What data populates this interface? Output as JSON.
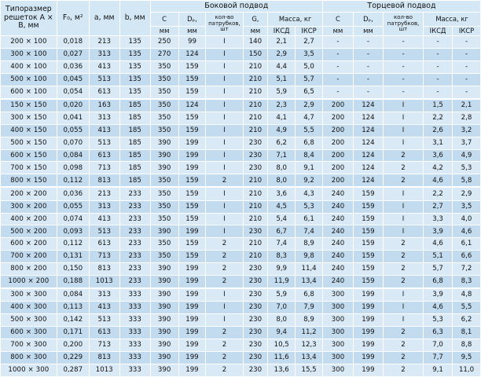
{
  "headers": {
    "size": "Типоразмер решеток А × В, мм",
    "f0": "F₀, м²",
    "a": "a, мм",
    "b": "b, мм",
    "side_group": "Боковой подвод",
    "end_group": "Торцевой подвод",
    "c": "С",
    "d": "Dₚ,",
    "count": "кол-во патрубков, шт",
    "g": "G,",
    "mass": "Масса, кг",
    "unit_mm": "мм",
    "ikcd": "IКСД",
    "ikcr": "IКСР"
  },
  "rows": [
    [
      "200 × 100",
      "0,018",
      "213",
      "135",
      "250",
      "99",
      "I",
      "140",
      "2,1",
      "2,7",
      "-",
      "-",
      "-",
      "-",
      "-"
    ],
    [
      "300 × 100",
      "0,027",
      "313",
      "135",
      "270",
      "124",
      "I",
      "150",
      "2,9",
      "3,5",
      "-",
      "-",
      "-",
      "-",
      "-"
    ],
    [
      "400 × 100",
      "0,036",
      "413",
      "135",
      "350",
      "159",
      "I",
      "210",
      "4,4",
      "5,0",
      "-",
      "-",
      "-",
      "-",
      "-"
    ],
    [
      "500 × 100",
      "0,045",
      "513",
      "135",
      "350",
      "159",
      "I",
      "210",
      "5,1",
      "5,7",
      "-",
      "-",
      "-",
      "-",
      "-"
    ],
    [
      "600 × 100",
      "0,054",
      "613",
      "135",
      "350",
      "159",
      "I",
      "210",
      "5,9",
      "6,5",
      "-",
      "-",
      "-",
      "-",
      "-"
    ],
    [
      "150 × 150",
      "0,020",
      "163",
      "185",
      "350",
      "124",
      "I",
      "210",
      "2,3",
      "2,9",
      "200",
      "124",
      "I",
      "1,5",
      "2,1"
    ],
    [
      "300 × 150",
      "0,041",
      "313",
      "185",
      "350",
      "159",
      "I",
      "210",
      "4,1",
      "4,7",
      "200",
      "124",
      "I",
      "2,2",
      "2,8"
    ],
    [
      "400 × 150",
      "0,055",
      "413",
      "185",
      "350",
      "159",
      "I",
      "210",
      "4,9",
      "5,5",
      "200",
      "124",
      "I",
      "2,6",
      "3,2"
    ],
    [
      "500 × 150",
      "0,070",
      "513",
      "185",
      "390",
      "199",
      "I",
      "230",
      "6,2",
      "6,8",
      "200",
      "124",
      "I",
      "3,1",
      "3,7"
    ],
    [
      "600 × 150",
      "0,084",
      "613",
      "185",
      "390",
      "199",
      "I",
      "230",
      "7,1",
      "8,4",
      "200",
      "124",
      "2",
      "3,6",
      "4,9"
    ],
    [
      "700 × 150",
      "0,098",
      "713",
      "185",
      "390",
      "199",
      "I",
      "230",
      "8,0",
      "9,1",
      "200",
      "124",
      "2",
      "4,2",
      "5,3"
    ],
    [
      "800 × 150",
      "0,112",
      "813",
      "185",
      "350",
      "159",
      "2",
      "210",
      "8,0",
      "9,2",
      "200",
      "124",
      "2",
      "4,6",
      "5,8"
    ],
    [
      "200 × 200",
      "0,036",
      "213",
      "233",
      "350",
      "159",
      "I",
      "210",
      "3,6",
      "4,3",
      "240",
      "159",
      "I",
      "2,2",
      "2,9"
    ],
    [
      "300 × 200",
      "0,055",
      "313",
      "233",
      "350",
      "159",
      "I",
      "210",
      "4,5",
      "5,3",
      "240",
      "159",
      "I",
      "2,7",
      "3,5"
    ],
    [
      "400 × 200",
      "0,074",
      "413",
      "233",
      "350",
      "159",
      "I",
      "210",
      "5,4",
      "6,1",
      "240",
      "159",
      "I",
      "3,3",
      "4,0"
    ],
    [
      "500 × 200",
      "0,093",
      "513",
      "233",
      "390",
      "199",
      "I",
      "230",
      "6,7",
      "7,4",
      "240",
      "159",
      "I",
      "3,9",
      "4,6"
    ],
    [
      "600 × 200",
      "0,112",
      "613",
      "233",
      "350",
      "159",
      "2",
      "210",
      "7,4",
      "8,9",
      "240",
      "159",
      "2",
      "4,6",
      "6,1"
    ],
    [
      "700 × 200",
      "0,131",
      "713",
      "233",
      "350",
      "159",
      "2",
      "210",
      "8,3",
      "9,8",
      "240",
      "159",
      "2",
      "5,1",
      "6,6"
    ],
    [
      "800 × 200",
      "0,150",
      "813",
      "233",
      "390",
      "199",
      "2",
      "230",
      "9,9",
      "11,4",
      "240",
      "159",
      "2",
      "5,7",
      "7,2"
    ],
    [
      "1000 × 200",
      "0,188",
      "1013",
      "233",
      "390",
      "199",
      "2",
      "230",
      "11,9",
      "13,4",
      "240",
      "159",
      "2",
      "6,8",
      "8,3"
    ],
    [
      "300 × 300",
      "0,084",
      "313",
      "333",
      "390",
      "199",
      "I",
      "230",
      "5,9",
      "6,8",
      "300",
      "199",
      "I",
      "3,9",
      "4,8"
    ],
    [
      "400 × 300",
      "0,113",
      "413",
      "333",
      "390",
      "199",
      "I",
      "230",
      "7,0",
      "7,9",
      "300",
      "199",
      "I",
      "4,6",
      "5,5"
    ],
    [
      "500 × 300",
      "0,142",
      "513",
      "333",
      "390",
      "199",
      "I",
      "230",
      "8,0",
      "8,9",
      "300",
      "199",
      "I",
      "5,3",
      "6,2"
    ],
    [
      "600 × 300",
      "0,171",
      "613",
      "333",
      "390",
      "199",
      "2",
      "230",
      "9,4",
      "11,2",
      "300",
      "199",
      "2",
      "6,3",
      "8,1"
    ],
    [
      "700 × 300",
      "0,200",
      "713",
      "333",
      "390",
      "199",
      "2",
      "230",
      "10,5",
      "12,3",
      "300",
      "199",
      "2",
      "7,0",
      "8,8"
    ],
    [
      "800 × 300",
      "0,229",
      "813",
      "333",
      "390",
      "199",
      "2",
      "230",
      "11,6",
      "13,4",
      "300",
      "199",
      "2",
      "7,7",
      "9,5"
    ],
    [
      "1000 × 300",
      "0,287",
      "1013",
      "333",
      "390",
      "199",
      "2",
      "230",
      "13,6",
      "15,5",
      "300",
      "199",
      "2",
      "9,1",
      "11,0"
    ]
  ]
}
